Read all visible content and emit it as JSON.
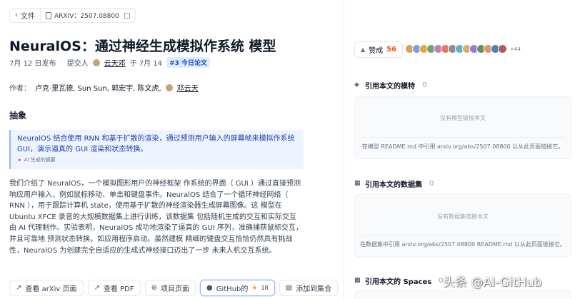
{
  "breadcrumb": {
    "back_label": "文件",
    "arxiv_label": "ARXIV：2507.08800"
  },
  "paper": {
    "title": "NeuralOS：通过神经生成模拟作系统 模型",
    "published": "7月 12 日发布",
    "submitted_by_label": "提交人",
    "submitter": "云天邓",
    "submitted_on": "于 7月 14",
    "daily_rank_tag": "#3 今日论文",
    "authors_label": "作者：",
    "authors": "卢克·里瓦德,  Sun Sun,  郭宏宇,  陈文虎,",
    "author_last": "邓云天"
  },
  "abstract": {
    "heading": "抽象",
    "ai_summary": "NeuralOS 结合使用 RNN 和基于扩散的渲染，通过预测用户输入的屏幕帧来模拟作系统 GUI，演示逼真的 GUI 渲染和状态转换。",
    "ai_summary_label": "AI 生成的摘要",
    "text": "我们介绍了 NeuralOS，一个模拟图形用户的神经框架 作系统的界面（ GUI ）通过直接预测 响应用户输入，例如鼠标移动、单击和键盘事件。NeuralOS 结合了一个循环神经网络（ RNN ），用于跟踪计算机 state，使用基于扩散的神经渲染器生成屏幕图像。这 模型在 Ubuntu XFCE 录音的大规模数据集上进行训练，该数据集 包括随机生成的交互和实际交互 由 AI 代理制作。实验表明，NeuralOS 成功地渲染了逼真的 GUI 序列，准确捕获鼠标交互，并且可靠地 预测状态转换，如应用程序启动。虽然建模 精细的键盘交互恰恰仍然具有挑战性，NeuralOS 为创建完全自适应的生成式神经接口迈出了一步 未来人机交互系统。"
  },
  "actions": {
    "arxiv_page": "查看 arXiv 页面",
    "pdf": "查看 PDF",
    "project_page": "项目页面",
    "github": "GitHub的",
    "github_stars": "18",
    "add_collection": "添加到集合"
  },
  "sidebar": {
    "upvote_label": "赞成",
    "upvote_count": "56",
    "avatars_more": "+44",
    "models": {
      "title": "引用本文的模特",
      "count": "0",
      "empty": "没有模型链接本文",
      "hint": "在模型 README.md 中引用 arxiv.org/abs/2507.08800 以从此页面链接它。"
    },
    "datasets": {
      "title": "引用本文的数据集",
      "count": "0",
      "empty": "没有数据集链接本文",
      "hint": "在数据集中引用 arxiv.org/abs/2507.08800 README.md 以从此页面链接它。"
    },
    "spaces": {
      "title": "引用本文的 Spaces",
      "count": "0"
    }
  },
  "watermark": "头条 @AI-GitHub",
  "colors": {
    "accent_orange": "#ea580c",
    "tag_blue": "#1d4ed8",
    "summary_bg": "#eef4ff",
    "star": "#f59e0b"
  },
  "avatar_colors": [
    "#d9a066",
    "#7c9ee0",
    "#e8a53b",
    "#6aa56b",
    "#c77dba",
    "#e07b6a",
    "#8e8e8e",
    "#5fb3c7",
    "#d4b16a",
    "#9b7ad6",
    "#6c8f5a",
    "#e0966a",
    "#4e7fc2",
    "#b05c5c"
  ]
}
